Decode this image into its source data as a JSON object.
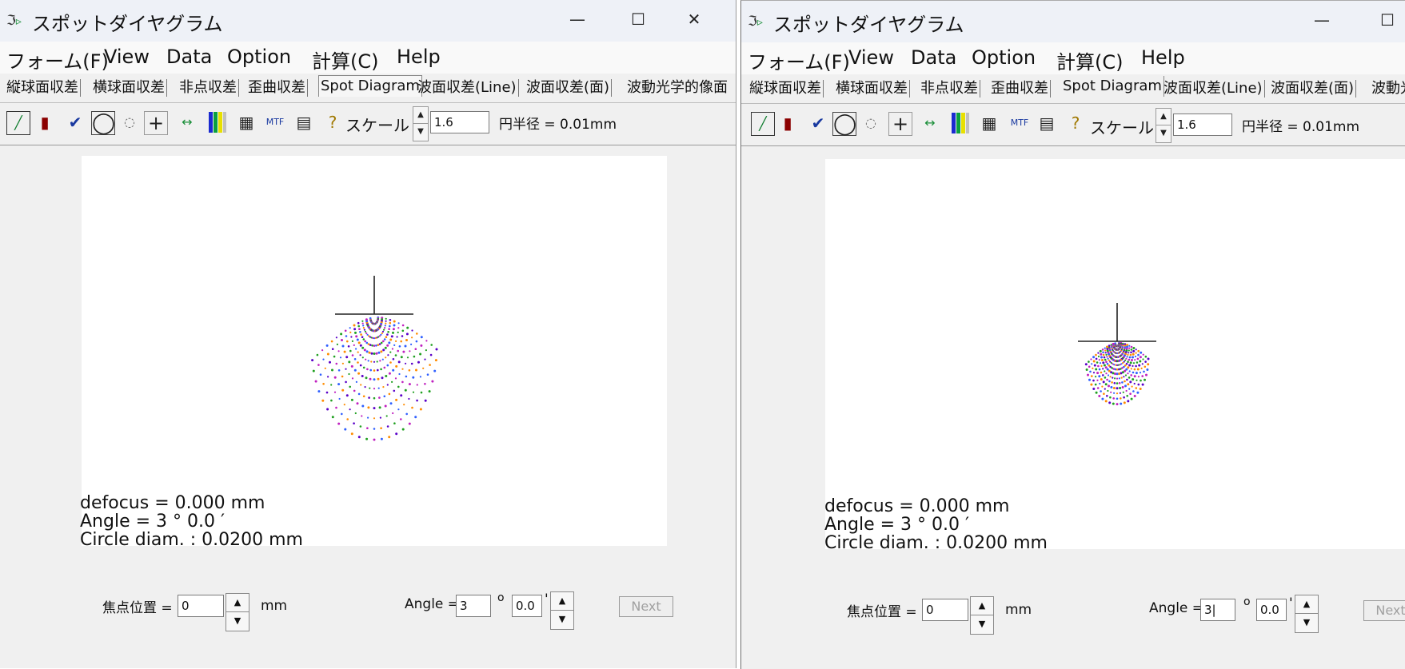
{
  "app": {
    "title": "スポットダイヤグラム",
    "minimize": "—",
    "maximize": "☐",
    "close": "✕"
  },
  "menu": [
    "フォーム(F)",
    "View",
    "Data",
    "Option",
    "計算(C)",
    "Help"
  ],
  "tabs": [
    "縦球面収差",
    "横球面収差",
    "非点収差",
    "歪曲収差",
    "Spot Diagram",
    "波面収差(Line)",
    "波面収差(面)",
    "波動光学的像面"
  ],
  "tabs_right_last": "波動光",
  "active_tab": "Spot Diagram",
  "toolbar": {
    "icons": [
      "aberration-graph-icon",
      "book-icon",
      "pencil-check-icon",
      "large-circle-icon",
      "small-circle-icon",
      "crosshair-icon",
      "lens-arrows-icon",
      "color-bars-icon",
      "grid-icon",
      "mtf-icon",
      "calculator-icon",
      "help-icon"
    ],
    "scale_label": "スケール",
    "scale_value": "1.6",
    "circle_radius_label": "円半径 = 0.01mm"
  },
  "plot": {
    "defocus": "defocus = 0.000 mm",
    "angle": "Angle   = 3 °  0.0 ′",
    "circle_diam": "Circle diam. : 0.0200 mm"
  },
  "bottom": {
    "focus_label": "焦点位置 =",
    "focus_value": "0",
    "focus_unit": "mm",
    "angle_label": "Angle =",
    "angle_left_value": "3",
    "angle_right_value": "3|",
    "degree_symbol": "o",
    "minutes_value": "0.0",
    "minutes_symbol": "'",
    "next_label": "Next",
    "next_label_right": "Next"
  },
  "colors": {
    "spot_colors": [
      "#ff8c00",
      "#3060ff",
      "#c020c0",
      "#20a020",
      "#5a00c8"
    ]
  }
}
